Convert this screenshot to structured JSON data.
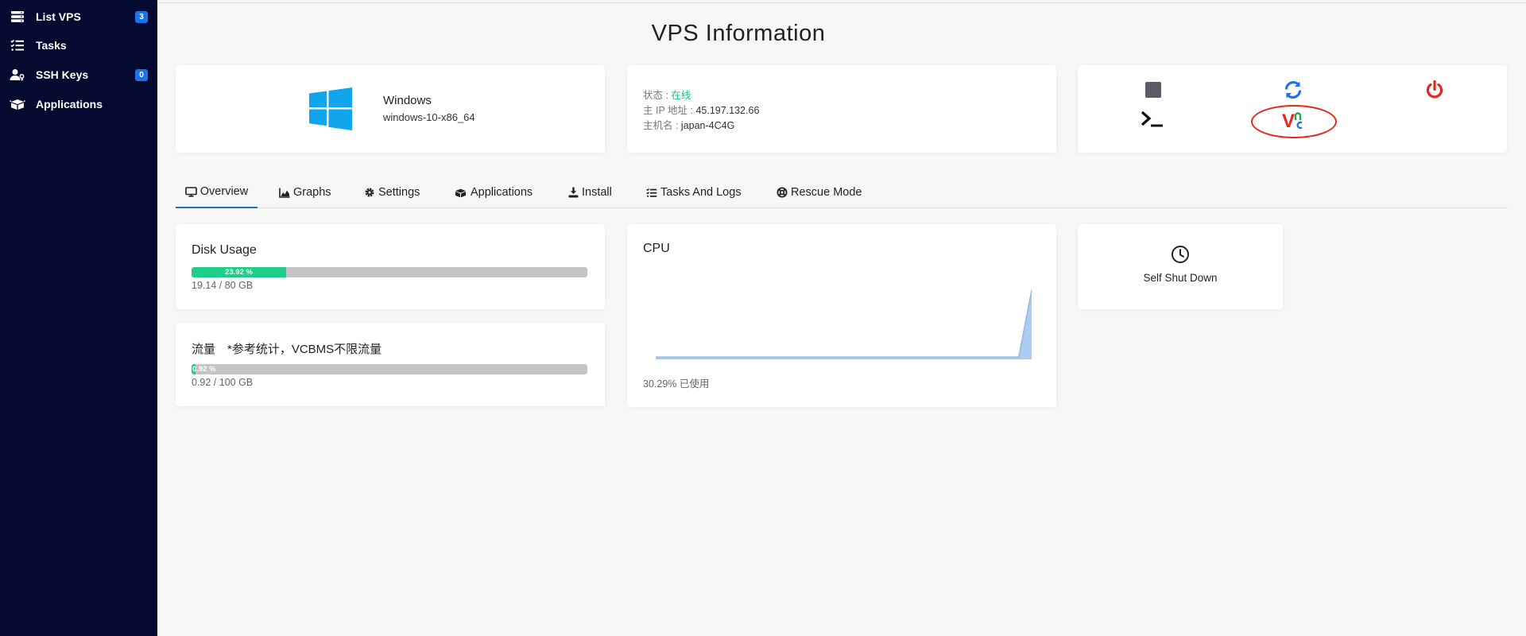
{
  "sidebar": {
    "items": [
      {
        "label": "List VPS",
        "icon": "server-stack-icon",
        "badge": "3"
      },
      {
        "label": "Tasks",
        "icon": "task-list-icon",
        "badge": ""
      },
      {
        "label": "SSH Keys",
        "icon": "user-key-icon",
        "badge": "0"
      },
      {
        "label": "Applications",
        "icon": "boxes-icon",
        "badge": ""
      }
    ]
  },
  "page": {
    "title": "VPS Information"
  },
  "os": {
    "name": "Windows",
    "version": "windows-10-x86_64"
  },
  "info": {
    "status_key": "状态 : ",
    "status_value": "在线",
    "ip_key": "主 IP 地址 : ",
    "ip_value": "45.197.132.66",
    "host_key": "主机名 : ",
    "host_value": "japan-4C4G"
  },
  "actions": {
    "stop": "stop-icon",
    "restart": "refresh-icon",
    "power": "power-icon",
    "console": "terminal-icon",
    "vnc": "vnc-icon",
    "vnc_text": "V"
  },
  "tabs": [
    {
      "label": "Overview",
      "icon": "monitor-icon"
    },
    {
      "label": "Graphs",
      "icon": "area-chart-icon"
    },
    {
      "label": "Settings",
      "icon": "gear-icon"
    },
    {
      "label": "Applications",
      "icon": "boxes-icon"
    },
    {
      "label": "Install",
      "icon": "download-icon"
    },
    {
      "label": "Tasks And Logs",
      "icon": "task-list-icon"
    },
    {
      "label": "Rescue Mode",
      "icon": "lifebuoy-icon"
    }
  ],
  "disk": {
    "title": "Disk Usage",
    "percent_label": "23.92 %",
    "percent": 23.92,
    "usage": "19.14 / 80 GB"
  },
  "traffic": {
    "title": "流量　*参考统计，VCBMS不限流量",
    "percent_label": "0.92 %",
    "percent": 0.92,
    "usage": "0.92 / 100 GB"
  },
  "cpu": {
    "title": "CPU",
    "usage_text": "30.29% 已使用",
    "chart_data": {
      "type": "area",
      "values": [
        1,
        1,
        1,
        1,
        1,
        1,
        1,
        1,
        1,
        1,
        1,
        1,
        1,
        1,
        1,
        1,
        1,
        1,
        1,
        1,
        1,
        1,
        1,
        1,
        1,
        1,
        1,
        1,
        1,
        30.29
      ],
      "ylim": [
        0,
        35
      ],
      "color": "#a9ccf0"
    }
  },
  "self_shutdown": {
    "label": "Self Shut Down"
  },
  "colors": {
    "sidebar_bg": "#050a30",
    "accent_blue": "#1a6fd6",
    "online_green": "#12c486",
    "progress_green": "#1fcc8a",
    "power_red": "#e8251b"
  }
}
